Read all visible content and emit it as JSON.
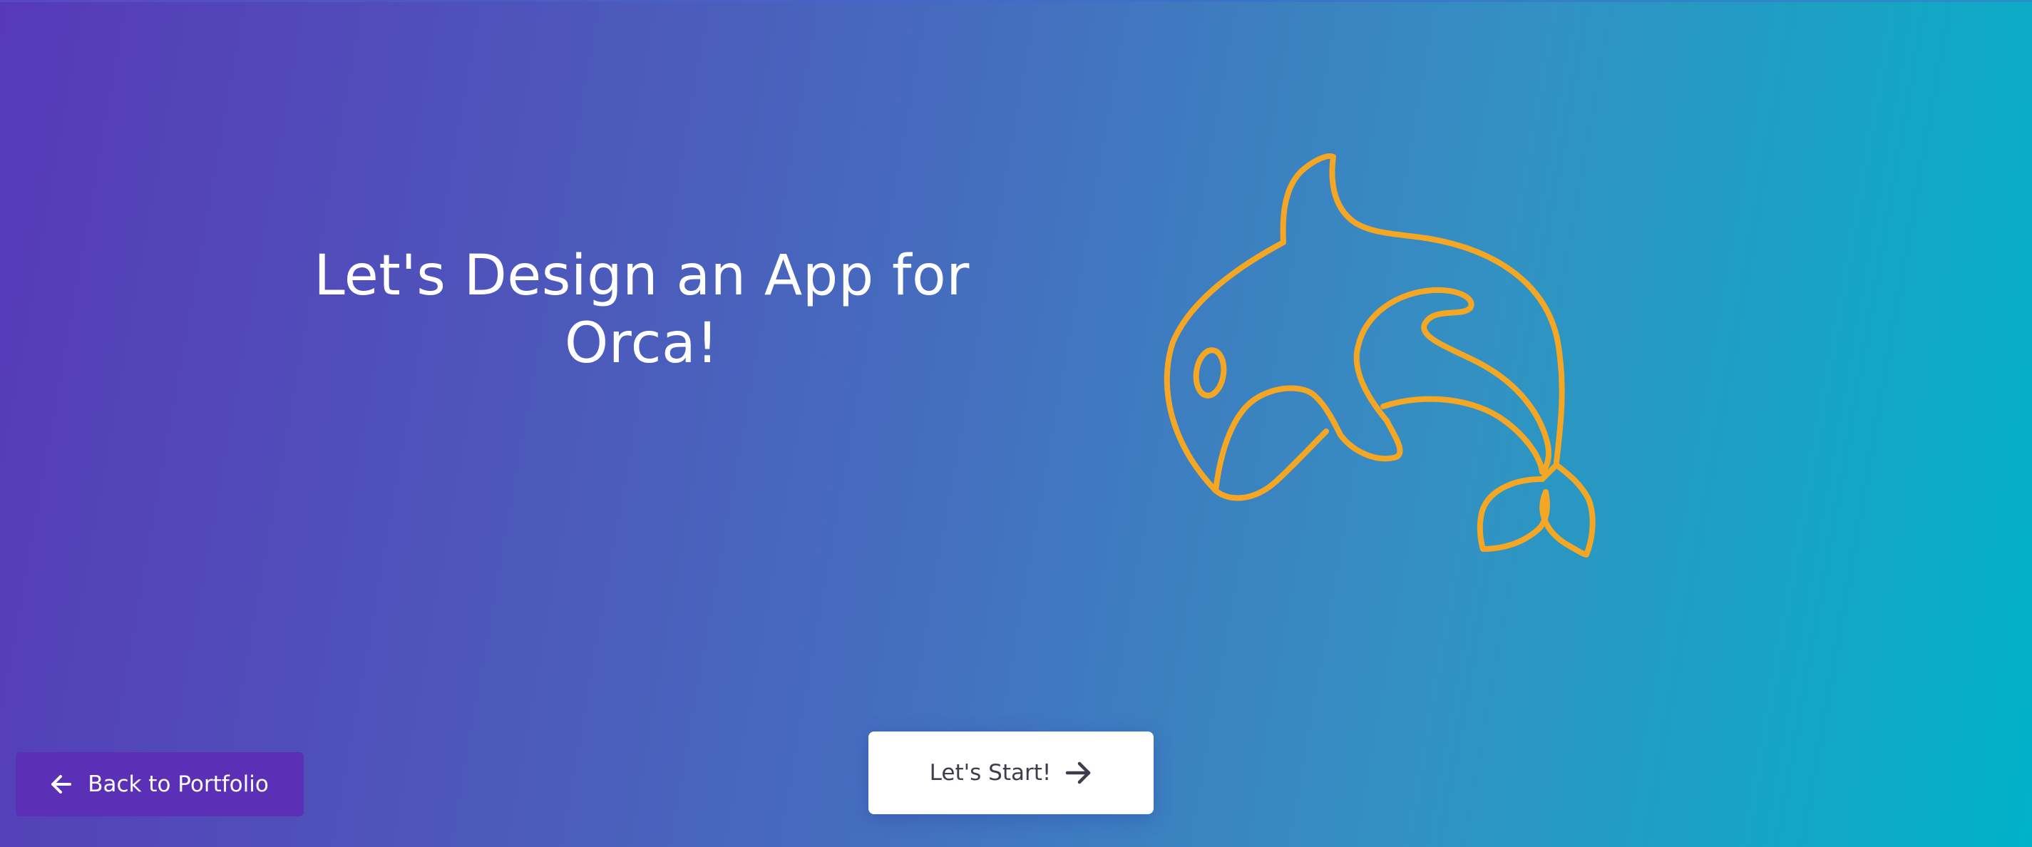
{
  "hero": {
    "headline_line1": "Let's Design an App for",
    "headline_line2": "Orca!",
    "illustration_icon": "orca-outline-icon",
    "illustration_color": "#f5a623"
  },
  "actions": {
    "start_label": "Let's Start!",
    "start_icon": "arrow-right-icon",
    "back_label": "Back to Portfolio",
    "back_icon": "arrow-left-icon"
  },
  "colors": {
    "gradient_start": "#5739b8",
    "gradient_end": "#00b2c9",
    "back_button_bg": "#5b2fb6",
    "start_button_bg": "#ffffff",
    "start_button_text": "#3d3d4d"
  }
}
